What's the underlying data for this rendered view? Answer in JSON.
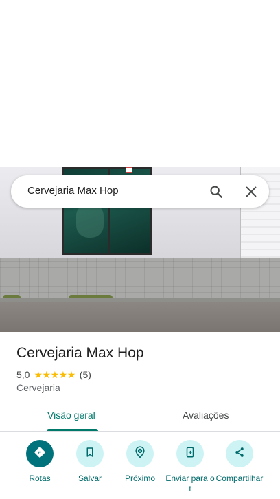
{
  "search": {
    "query": "Cervejaria Max Hop",
    "icons": {
      "search": "search-icon",
      "close": "close-icon"
    }
  },
  "place": {
    "name": "Cervejaria Max Hop",
    "rating": "5,0",
    "stars": 5,
    "review_count": "(5)",
    "category": "Cervejaria"
  },
  "tabs": [
    {
      "label": "Visão geral",
      "selected": true
    },
    {
      "label": "Avaliações",
      "selected": false
    }
  ],
  "actions": [
    {
      "label": "Rotas",
      "icon": "directions-icon"
    },
    {
      "label": "Salvar",
      "icon": "bookmark-icon"
    },
    {
      "label": "Próximo",
      "icon": "nearby-icon"
    },
    {
      "label": "Enviar para o t",
      "icon": "send-to-phone-icon"
    },
    {
      "label": "Compartilhar",
      "icon": "share-icon"
    }
  ],
  "colors": {
    "accent": "#00796b",
    "primary_action": "#00727b",
    "action_bg": "#cdf3f5",
    "star": "#fbbc04"
  }
}
